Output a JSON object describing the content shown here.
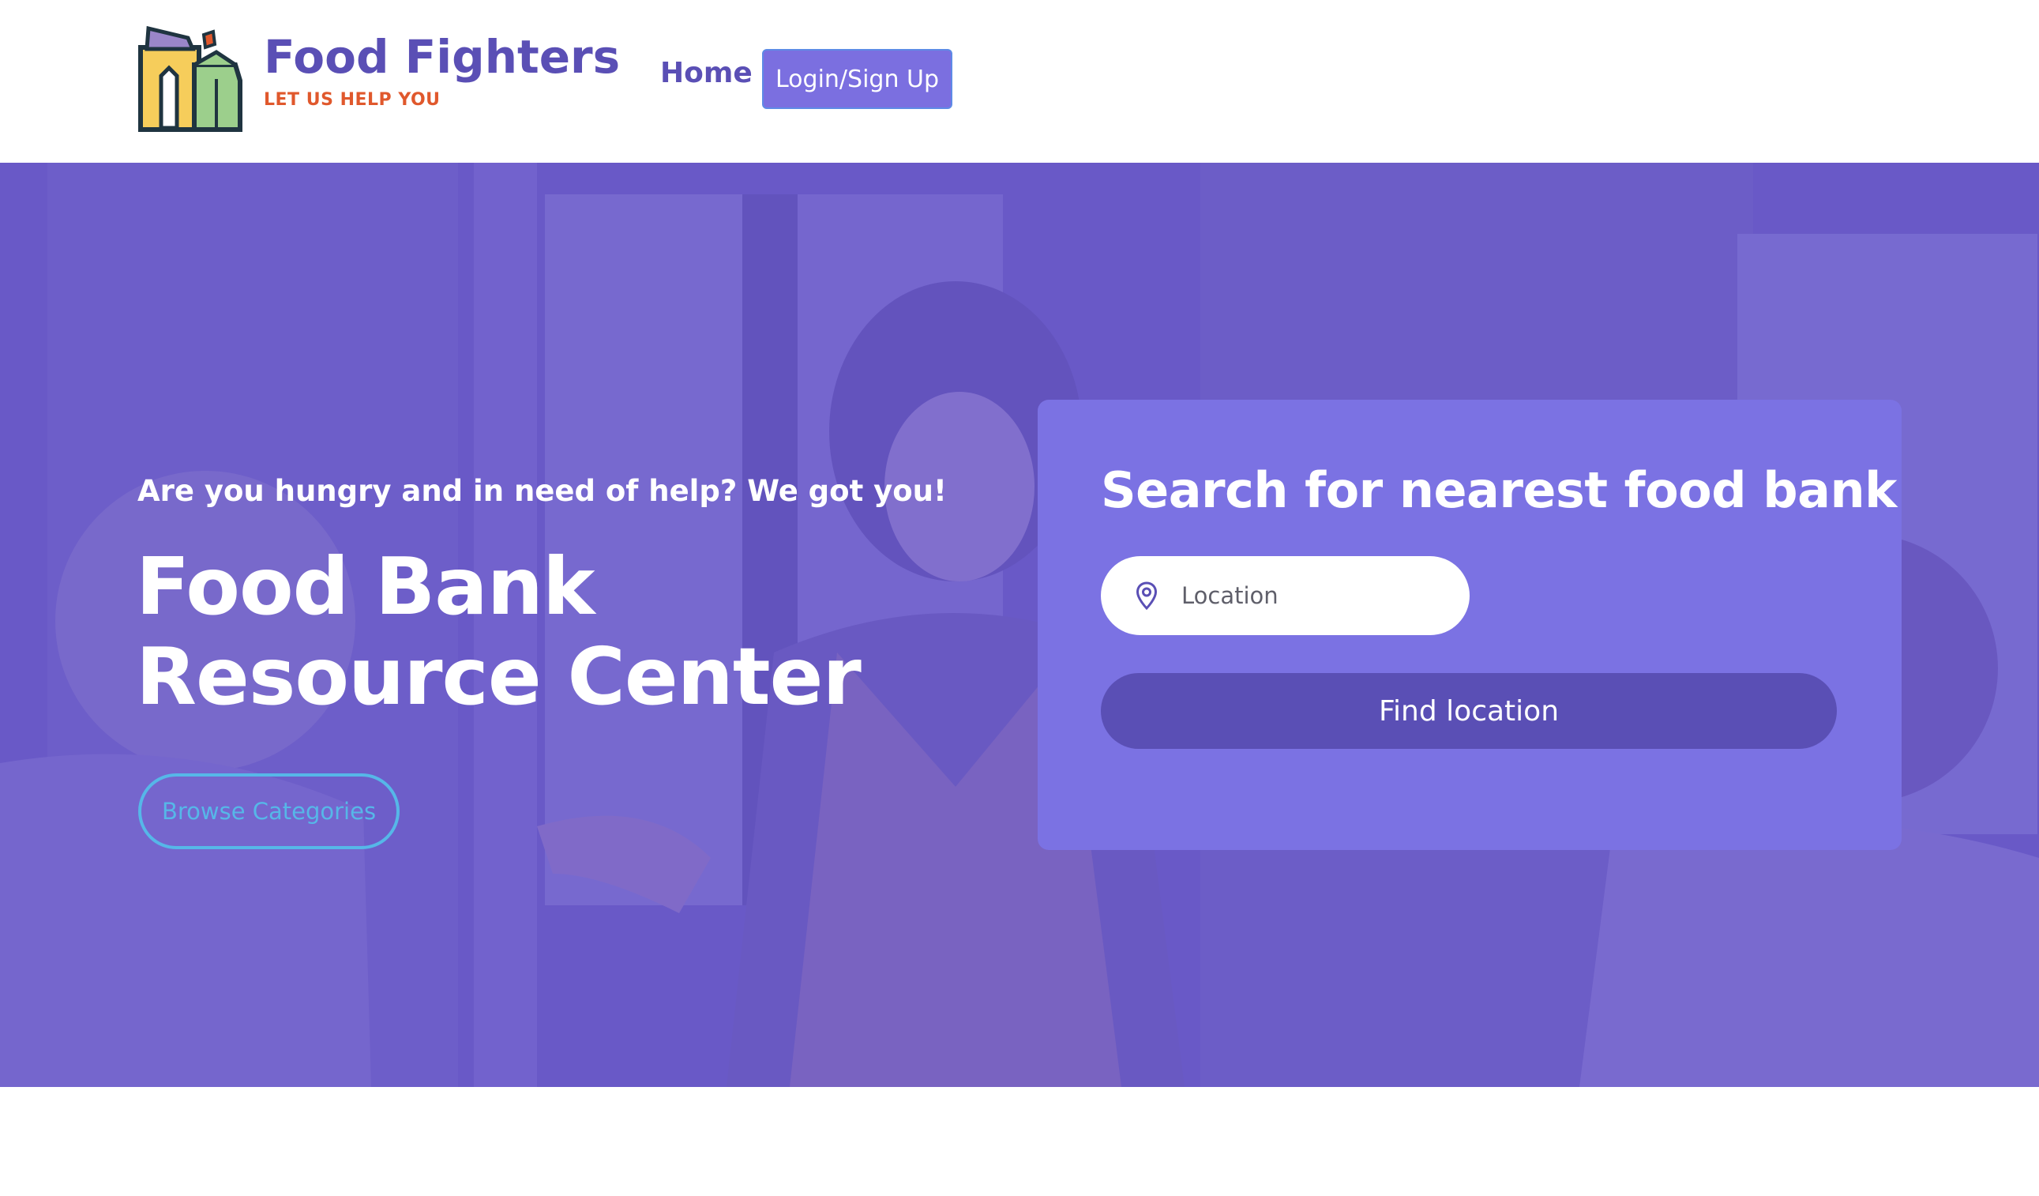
{
  "brand": {
    "name": "Food Fighters",
    "tagline": "LET US HELP YOU",
    "logo_icon": "grocery-bag-icon"
  },
  "nav": {
    "home_label": "Home",
    "login_label": "Login/Sign Up"
  },
  "hero": {
    "subtitle": "Are you hungry and in need of help? We got you!",
    "title": "Food Bank Resource Center",
    "browse_label": "Browse Categories",
    "background": "photo-of-woman-presenting-to-group"
  },
  "search": {
    "title": "Search for nearest food bank",
    "location_placeholder": "Location",
    "location_value": "",
    "location_icon": "map-pin-icon",
    "find_label": "Find location"
  },
  "colors": {
    "brand_purple": "#5a4fb5",
    "accent_orange": "#e0582c",
    "card_purple": "#7b72e3",
    "button_outline_blue": "#56b7e8",
    "overlay_purple": "#6758c8"
  }
}
